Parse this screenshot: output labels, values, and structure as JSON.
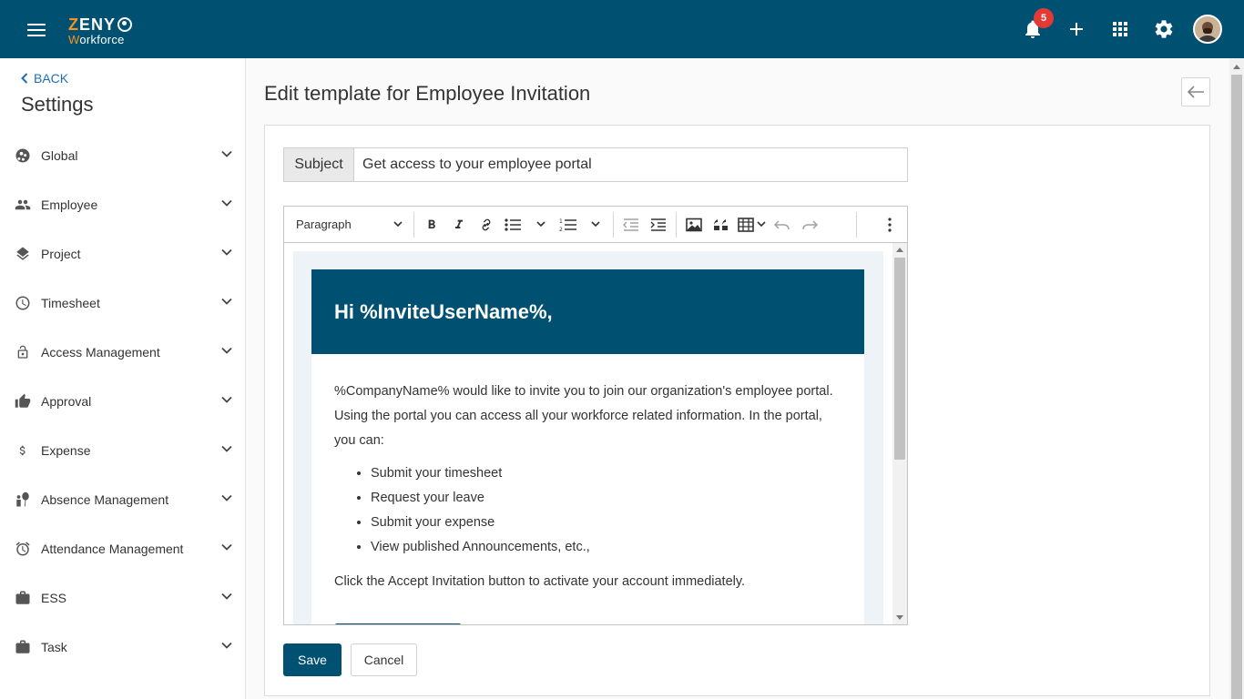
{
  "app": {
    "logo_top": "ZENY",
    "logo_bottom": "Workforce",
    "notifications_count": "5"
  },
  "icons": {
    "menu": "hamburger-icon",
    "notifications": "bell-icon",
    "add": "plus-icon",
    "apps": "grid-icon",
    "settings": "gear-icon"
  },
  "colors": {
    "primary": "#005171",
    "accent": "#f7941d",
    "badge": "#e53935",
    "link": "#1f6fb2"
  },
  "sidebar": {
    "back_label": "BACK",
    "title": "Settings",
    "items": [
      {
        "label": "Global",
        "icon": "globe-icon"
      },
      {
        "label": "Employee",
        "icon": "people-icon"
      },
      {
        "label": "Project",
        "icon": "layers-icon"
      },
      {
        "label": "Timesheet",
        "icon": "clock-icon"
      },
      {
        "label": "Access Management",
        "icon": "lock-icon"
      },
      {
        "label": "Approval",
        "icon": "thumbs-up-icon"
      },
      {
        "label": "Expense",
        "icon": "dollar-icon"
      },
      {
        "label": "Absence Management",
        "icon": "person-balloon-icon"
      },
      {
        "label": "Attendance Management",
        "icon": "alarm-icon"
      },
      {
        "label": "ESS",
        "icon": "briefcase-icon"
      },
      {
        "label": "Task",
        "icon": "briefcase-icon"
      }
    ]
  },
  "main": {
    "title": "Edit template for Employee Invitation",
    "subject_label": "Subject",
    "subject_value": "Get access to your employee portal",
    "toolbar": {
      "paragraph_label": "Paragraph"
    },
    "email": {
      "greeting": "Hi %InviteUserName%,",
      "intro": "%CompanyName% would like to invite you to join our organization's employee portal. Using the portal you can access all your workforce related information. In the portal, you can:",
      "bullets": [
        "Submit your timesheet",
        "Request your leave",
        "Submit your expense",
        "View published Announcements, etc.,"
      ],
      "cta_text": "Click the Accept Invitation button to activate your account immediately."
    },
    "save_label": "Save",
    "cancel_label": "Cancel"
  }
}
